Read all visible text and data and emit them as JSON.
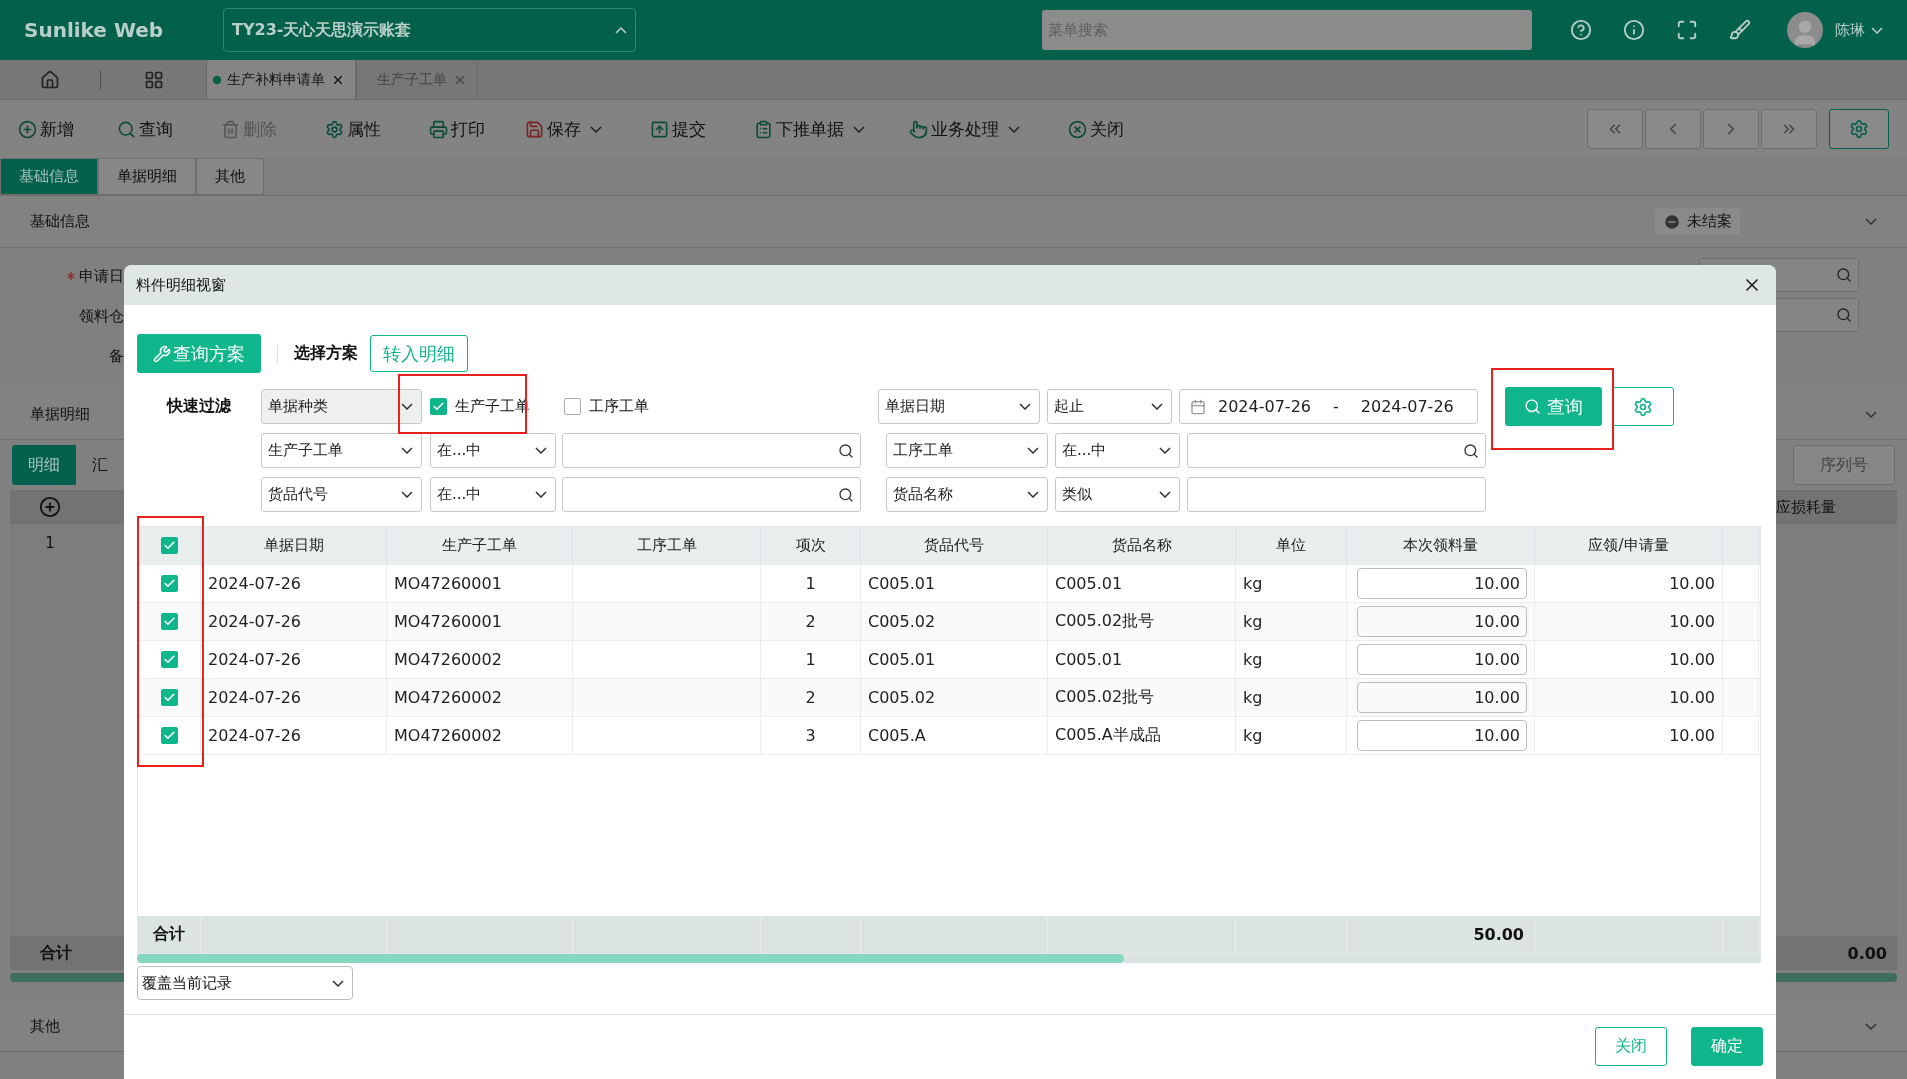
{
  "header": {
    "logo": "Sunlike Web",
    "account": "TY23-天心天思演示账套",
    "search_placeholder": "菜单搜索",
    "user": "陈琳"
  },
  "doc_tabs": [
    {
      "label": "生产补料申请单",
      "selected": true
    },
    {
      "label": "生产子工单",
      "selected": false
    }
  ],
  "toolbar": [
    {
      "label": "新增",
      "disabled": false,
      "dropdown": false
    },
    {
      "label": "查询",
      "disabled": false,
      "dropdown": false
    },
    {
      "label": "删除",
      "disabled": true,
      "dropdown": false
    },
    {
      "label": "属性",
      "disabled": false,
      "dropdown": false
    },
    {
      "label": "打印",
      "disabled": false,
      "dropdown": false
    },
    {
      "label": "保存",
      "disabled": false,
      "dropdown": true
    },
    {
      "label": "提交",
      "disabled": false,
      "dropdown": false
    },
    {
      "label": "下推单据",
      "disabled": false,
      "dropdown": true
    },
    {
      "label": "业务处理",
      "disabled": false,
      "dropdown": true
    },
    {
      "label": "关闭",
      "disabled": false,
      "dropdown": false
    }
  ],
  "form_tabs": [
    {
      "label": "基础信息",
      "selected": true
    },
    {
      "label": "单据明细",
      "selected": false
    },
    {
      "label": "其他",
      "selected": false
    }
  ],
  "basic_info": {
    "title": "基础信息",
    "status": "未结案",
    "fields": [
      {
        "label": "申请日",
        "required": true
      },
      {
        "label": "领料仓",
        "required": false
      },
      {
        "label": "备",
        "required": false
      }
    ]
  },
  "detail": {
    "title": "单据明细",
    "tabs": [
      {
        "label": "明细",
        "selected": true
      },
      {
        "label": "汇",
        "selected": false
      }
    ],
    "serial_button": "序列号",
    "column_header": "应损耗量",
    "row_number": "1",
    "total_label": "合计",
    "total_value": "0.00"
  },
  "other": {
    "title": "其他"
  },
  "dialog": {
    "title": "料件明细视窗",
    "scheme_button": "查询方案",
    "scheme_label": "选择方案",
    "transfer_button": "转入明细",
    "quick_filter_label": "快速过滤",
    "type_filter": {
      "field": "单据种类",
      "options": [
        {
          "label": "生产子工单",
          "checked": true
        },
        {
          "label": "工序工单",
          "checked": false
        }
      ]
    },
    "date_filter": {
      "field": "单据日期",
      "operator": "起止",
      "from": "2024-07-26",
      "separator": "-",
      "to": "2024-07-26"
    },
    "filters": [
      {
        "field": "生产子工单",
        "operator": "在...中",
        "kind": "lookup"
      },
      {
        "field": "工序工单",
        "operator": "在...中",
        "kind": "lookup"
      },
      {
        "field": "货品代号",
        "operator": "在...中",
        "kind": "lookup"
      },
      {
        "field": "货品名称",
        "operator": "类似",
        "kind": "text"
      }
    ],
    "query_button": "查询",
    "table": {
      "all_selected": true,
      "columns": [
        "单据日期",
        "生产子工单",
        "工序工单",
        "项次",
        "货品代号",
        "货品名称",
        "单位",
        "本次领料量",
        "应领/申请量"
      ],
      "rows": [
        {
          "selected": true,
          "date": "2024-07-26",
          "order": "MO47260001",
          "item_no": "1",
          "code": "C005.01",
          "name": "C005.01",
          "unit": "kg",
          "qty": "10.00",
          "requested": "10.00"
        },
        {
          "selected": true,
          "date": "2024-07-26",
          "order": "MO47260001",
          "item_no": "2",
          "code": "C005.02",
          "name": "C005.02批号",
          "unit": "kg",
          "qty": "10.00",
          "requested": "10.00"
        },
        {
          "selected": true,
          "date": "2024-07-26",
          "order": "MO47260002",
          "item_no": "1",
          "code": "C005.01",
          "name": "C005.01",
          "unit": "kg",
          "qty": "10.00",
          "requested": "10.00"
        },
        {
          "selected": true,
          "date": "2024-07-26",
          "order": "MO47260002",
          "item_no": "2",
          "code": "C005.02",
          "name": "C005.02批号",
          "unit": "kg",
          "qty": "10.00",
          "requested": "10.00"
        },
        {
          "selected": true,
          "date": "2024-07-26",
          "order": "MO47260002",
          "item_no": "3",
          "code": "C005.A",
          "name": "C005.A半成品",
          "unit": "kg",
          "qty": "10.00",
          "requested": "10.00"
        }
      ],
      "total_label": "合计",
      "total_value": "50.00"
    },
    "mode_select": "覆盖当前记录",
    "buttons": [
      {
        "label": "关闭",
        "kind": "secondary"
      },
      {
        "label": "确定",
        "kind": "primary"
      }
    ]
  }
}
